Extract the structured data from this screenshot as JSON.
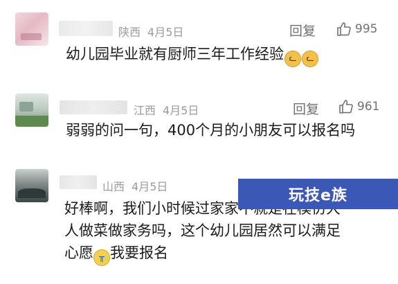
{
  "comments": [
    {
      "region": "陕西",
      "date": "4月5日",
      "reply_label": "回复",
      "likes": "995",
      "text": "幼儿园毕业就有厨师三年工作经验",
      "emoji": [
        "cat-face-icon",
        "cat-face-icon"
      ]
    },
    {
      "region": "江西",
      "date": "4月5日",
      "reply_label": "回复",
      "likes": "961",
      "text": "弱弱的问一句，400个月的小朋友可以报名吗"
    },
    {
      "region": "山西",
      "date": "4月5日",
      "text_lines": [
        "好棒啊，我们小时候过家家不就是在模仿大",
        "人做菜做家务吗，这个幼儿园居然可以满足"
      ],
      "text_line3_a": "心愿",
      "text_line3_b": "我要报名",
      "emoji": [
        "crying-face-icon"
      ]
    }
  ],
  "watermark": {
    "label": "玩技e族",
    "color": "#3c58b6"
  }
}
